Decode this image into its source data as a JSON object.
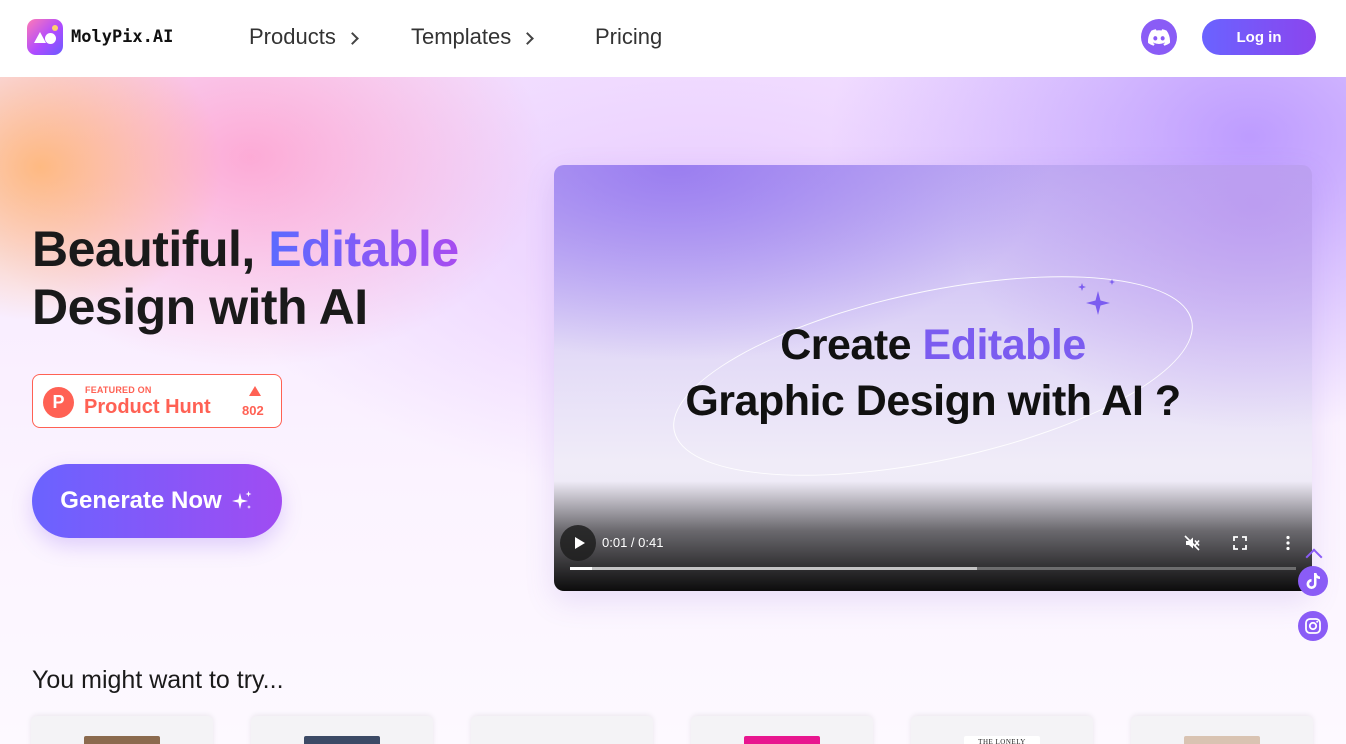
{
  "header": {
    "logo_text": "MolyPix.AI",
    "nav": [
      {
        "label": "Products",
        "has_chevron": true
      },
      {
        "label": "Templates",
        "has_chevron": true
      },
      {
        "label": "Pricing",
        "has_chevron": false
      }
    ],
    "discord_icon": "discord-icon",
    "login_label": "Log in"
  },
  "hero": {
    "headline_line1": "Beautiful, ",
    "headline_accent": "Editable",
    "headline_line2": "Design with AI",
    "product_hunt": {
      "featured_label": "FEATURED ON",
      "name": "Product Hunt",
      "upvotes": "802"
    },
    "generate_label": "Generate Now",
    "generate_icon": "sparkles-icon"
  },
  "video": {
    "title_line1_prefix": "Create ",
    "title_line1_accent": "Editable",
    "title_line2": "Graphic Design with AI ?",
    "time_display": "0:01 / 0:41",
    "progress_fraction": 0.03,
    "buffered_fraction": 0.56,
    "muted": true
  },
  "social": {
    "tiktok_icon": "tiktok-icon",
    "instagram_icon": "instagram-icon"
  },
  "try_section": {
    "title": "You might want to try...",
    "cards": [
      {
        "label": "",
        "thumb_color": "#8b6a4e"
      },
      {
        "label": "",
        "thumb_color": "#3c4a66"
      },
      {
        "label": "",
        "thumb_color": "#f4f3f6"
      },
      {
        "label": "",
        "thumb_color": "#e8168f"
      },
      {
        "label": "THE LONELY",
        "thumb_color": "#ffffff"
      },
      {
        "label": "",
        "thumb_color": "#d9c3b2"
      }
    ]
  },
  "colors": {
    "brand_purple": "#8a5cf6",
    "gradient_start": "#6a63ff",
    "gradient_end": "#a04cf2",
    "product_hunt": "#ff6154"
  }
}
